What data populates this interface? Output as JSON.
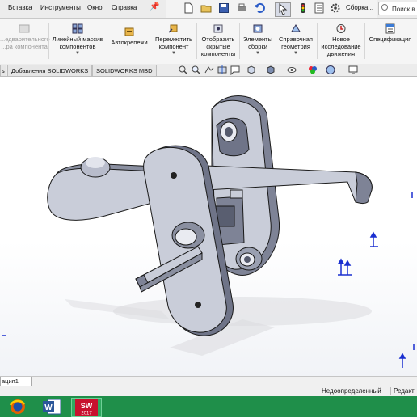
{
  "menubar": {
    "items": [
      "Вставка",
      "Инструменты",
      "Окно",
      "Справка"
    ],
    "search_label": "Поиск в"
  },
  "quick_access": {
    "icons": [
      "new-document-icon",
      "open-folder-icon",
      "save-icon",
      "print-icon",
      "undo-icon",
      "select-arrow-icon",
      "rebuild-icon",
      "file-properties-icon",
      "options-gear-icon"
    ],
    "document_label": "Сборка..."
  },
  "ribbon": {
    "buttons": [
      {
        "label": "...едварительного\n...ра компонента",
        "disabled": true
      },
      {
        "label": "Линейный массив\nкомпонентов",
        "caret": true
      },
      {
        "label": "Автокрепежи"
      },
      {
        "label": "Переместить\nкомпонент",
        "caret": true
      },
      {
        "label": "Отобразить\nскрытые\nкомпоненты"
      },
      {
        "label": "Элементы\nсборки",
        "caret": true
      },
      {
        "label": "Справочная\nгеометрия",
        "caret": true
      },
      {
        "label": "Новое\nисследование\nдвижения"
      },
      {
        "label": "Спецификация"
      }
    ]
  },
  "tabs": {
    "items": [
      "Добавления SOLIDWORKS",
      "SOLIDWORKS MBD"
    ]
  },
  "statusbar": {
    "doc_tab": "ация1",
    "state": "Недоопределенный",
    "mode": "Редакт"
  },
  "taskbar": {
    "apps": [
      "firefox-icon",
      "word-icon",
      "solidworks-icon"
    ],
    "solidworks_version": "2017"
  },
  "colors": {
    "accent_blue": "#1a2fd0",
    "part_fill": "#c9cdd9",
    "part_shade": "#8a8fa0",
    "taskbar": "#1f8f4a"
  }
}
